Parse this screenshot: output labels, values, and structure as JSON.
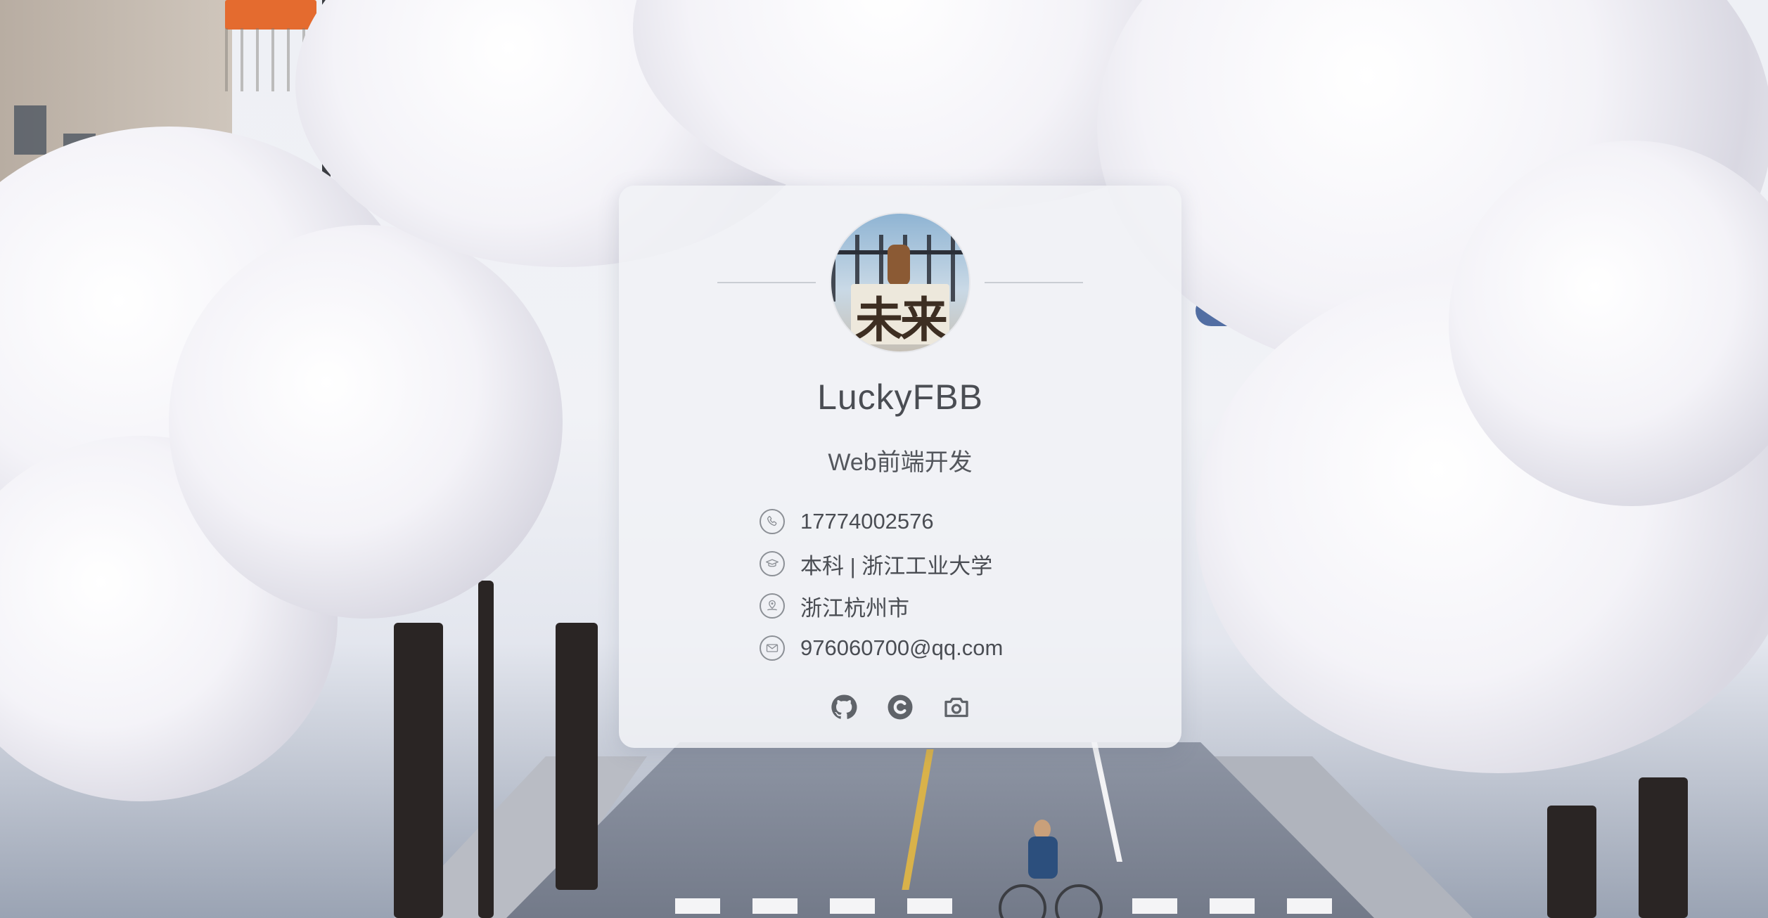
{
  "profile": {
    "name": "LuckyFBB",
    "role": "Web前端开发",
    "avatar_text": "未来"
  },
  "info": [
    {
      "icon": "phone-icon",
      "text": "17774002576"
    },
    {
      "icon": "graduation-cap-icon",
      "text": "本科 | 浙江工业大学"
    },
    {
      "icon": "location-icon",
      "text": "浙江杭州市"
    },
    {
      "icon": "mail-icon",
      "text": "976060700@qq.com"
    }
  ],
  "social": [
    {
      "icon": "github-icon"
    },
    {
      "icon": "circle-c-icon"
    },
    {
      "icon": "camera-icon"
    }
  ],
  "colors": {
    "card_background": "#f1f2f6",
    "text": "#4a4d53",
    "icon": "#8c9096",
    "background_sky": "#eef0f5"
  }
}
